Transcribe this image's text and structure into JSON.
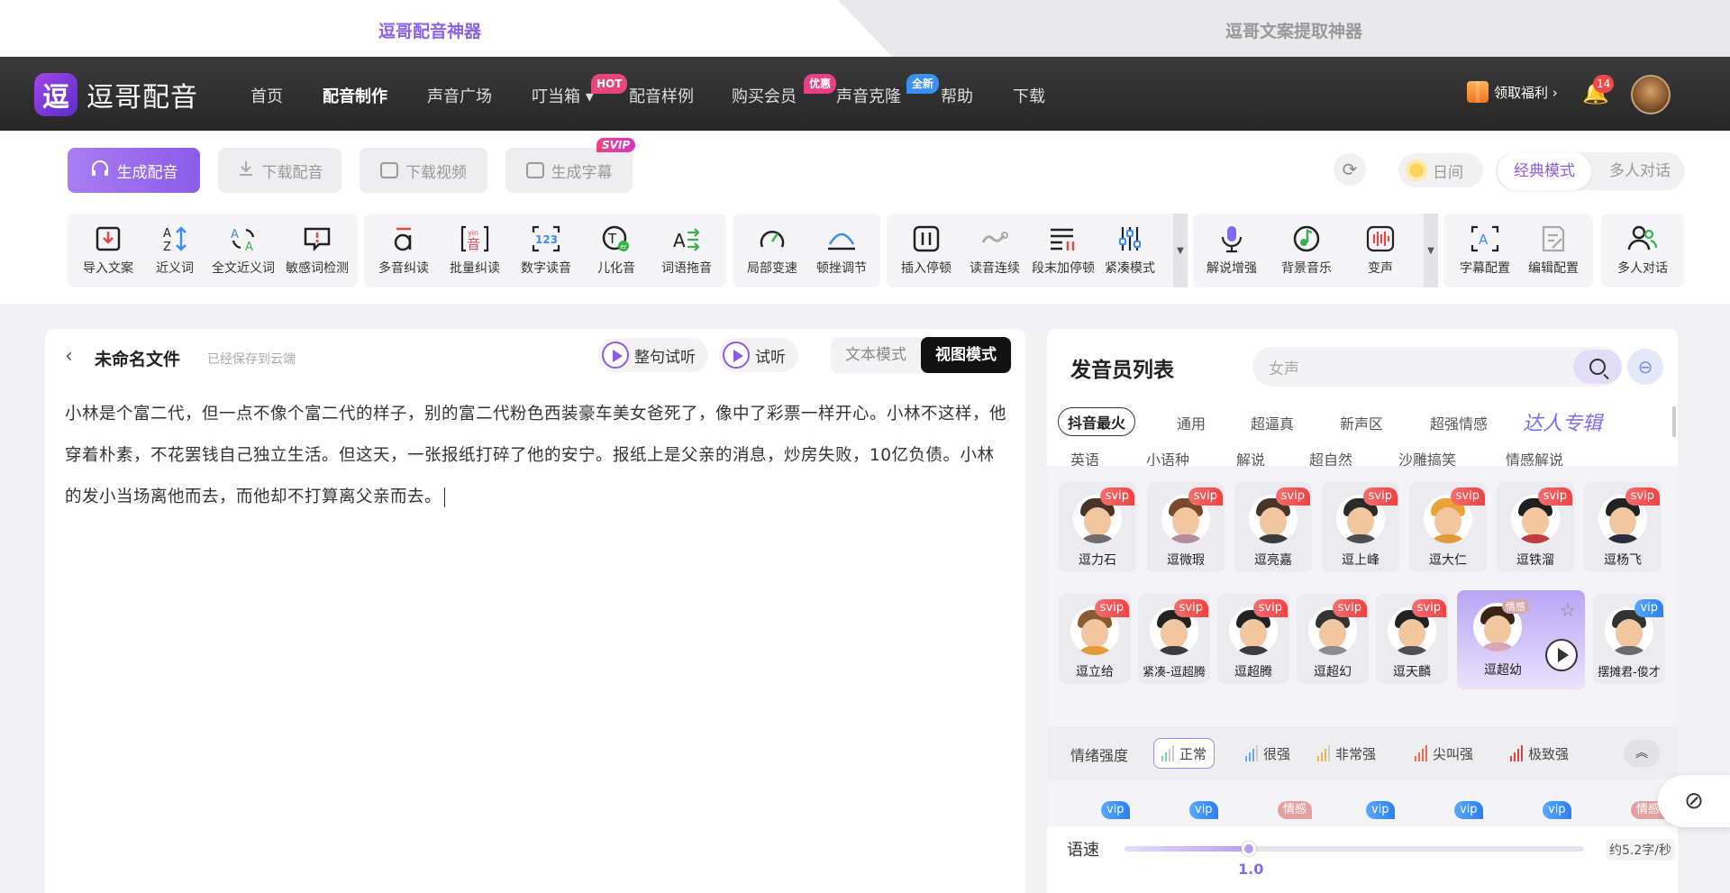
{
  "product_tabs": [
    "逗哥配音神器",
    "逗哥文案提取神器"
  ],
  "header": {
    "logo_glyph": "逗",
    "logo_text": "逗哥配音",
    "nav": [
      {
        "label": "首页",
        "active": false
      },
      {
        "label": "配音制作",
        "active": true
      },
      {
        "label": "声音广场",
        "active": false
      },
      {
        "label": "叮当箱 ▾",
        "active": false,
        "badge": "HOT"
      },
      {
        "label": "配音样例",
        "active": false
      },
      {
        "label": "购买会员",
        "active": false,
        "badge": "优惠"
      },
      {
        "label": "声音克隆",
        "active": false,
        "badge": "全新"
      },
      {
        "label": "帮助",
        "active": false
      },
      {
        "label": "下载",
        "active": false
      }
    ],
    "gift_label": "领取福利 ›",
    "notification_count": "14"
  },
  "actions": {
    "generate": "生成配音",
    "download_audio": "下载配音",
    "download_video": "下载视频",
    "generate_subtitle": "生成字幕",
    "svip": "SVIP"
  },
  "display": {
    "daytime": "日间",
    "mode_classic": "经典模式",
    "mode_multi": "多人对话"
  },
  "tools": [
    "导入文案",
    "近义词",
    "全文近义词",
    "敏感词检测",
    "多音纠读",
    "批量纠读",
    "数字读音",
    "儿化音",
    "词语拖音",
    "局部变速",
    "顿挫调节",
    "插入停顿",
    "读音连续",
    "段末加停顿",
    "紧凑模式",
    "解说增强",
    "背景音乐",
    "变声",
    "字幕配置",
    "编辑配置",
    "多人对话"
  ],
  "editor": {
    "file_name": "未命名文件",
    "save_status": "已经保存到云端",
    "sentence_preview": "整句试听",
    "preview": "试听",
    "text_mode": "文本模式",
    "view_mode": "视图模式",
    "content": "小林是个富二代，但一点不像个富二代的样子，别的富二代粉色西装豪车美女爸死了，像中了彩票一样开心。小林不这样，他穿着朴素，不花罢钱自己独立生活。但这天，一张报纸打碎了他的安宁。报纸上是父亲的消息，炒房失败，10亿负债。小林的发小当场离他而去，而他却不打算离父亲而去。"
  },
  "voices": {
    "title": "发音员列表",
    "search_placeholder": "女声",
    "categories_row1": [
      "抖音最火",
      "通用",
      "超逼真",
      "新声区",
      "超强情感",
      "达人专辑"
    ],
    "categories_row2": [
      "英语",
      "小语种",
      "解说",
      "超自然",
      "沙雕搞笑",
      "情感解说"
    ],
    "row1": [
      {
        "name": "逗力石",
        "badge": "svip"
      },
      {
        "name": "逗微瑕",
        "badge": "svip"
      },
      {
        "name": "逗亮嘉",
        "badge": "svip"
      },
      {
        "name": "逗上峰",
        "badge": "svip"
      },
      {
        "name": "逗大仁",
        "badge": "svip"
      },
      {
        "name": "逗铁溜",
        "badge": "svip"
      },
      {
        "name": "逗杨飞",
        "badge": "svip"
      }
    ],
    "row2": [
      {
        "name": "逗立给",
        "badge": "svip"
      },
      {
        "name": "紧凑-逗超腾",
        "badge": "svip"
      },
      {
        "name": "逗超腾",
        "badge": "svip"
      },
      {
        "name": "逗超幻",
        "badge": "svip"
      },
      {
        "name": "逗天麟",
        "badge": "svip"
      },
      {
        "name": "逗超幼",
        "badge": "情感",
        "selected": true
      },
      {
        "name": "摆摊君-俊才",
        "badge": "vip"
      }
    ],
    "row3_badges": [
      "vip",
      "vip",
      "情感",
      "vip",
      "vip",
      "vip",
      "情感"
    ],
    "emotion_label": "情绪强度",
    "emotions": [
      "正常",
      "很强",
      "非常强",
      "尖叫强",
      "极致强"
    ],
    "speed_label": "语速",
    "speed_value": "1.0",
    "speed_fraction": 0.27,
    "speed_rate": "约5.2字/秒"
  },
  "colors": {
    "accent": "#8b5bea",
    "svip": "#f04242",
    "vip": "#2d7ff0"
  }
}
